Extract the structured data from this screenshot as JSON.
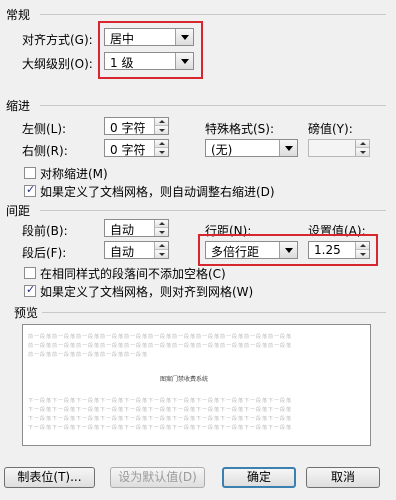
{
  "general": {
    "section_label": "常规",
    "alignment_label": "对齐方式(G):",
    "alignment_value": "居中",
    "outline_label": "大纲级别(O):",
    "outline_value": "1 级"
  },
  "indent": {
    "section_label": "缩进",
    "left_label": "左侧(L):",
    "left_value": "0 字符",
    "right_label": "右侧(R):",
    "right_value": "0 字符",
    "special_label": "特殊格式(S):",
    "special_value": "(无)",
    "by_label": "磅值(Y):",
    "by_value": "",
    "mirror_label": "对称缩进(M)",
    "mirror_checked": false,
    "auto_adjust_label": "如果定义了文档网格，则自动调整右缩进(D)",
    "auto_adjust_checked": true
  },
  "spacing": {
    "section_label": "间距",
    "before_label": "段前(B):",
    "before_value": "自动",
    "after_label": "段后(F):",
    "after_value": "自动",
    "line_spacing_label": "行距(N):",
    "line_spacing_value": "多倍行距",
    "at_label": "设置值(A):",
    "at_value": "1.25",
    "no_space_label": "在相同样式的段落间不添加空格(C)",
    "no_space_checked": false,
    "snap_grid_label": "如果定义了文档网格，则对齐到网格(W)",
    "snap_grid_checked": true
  },
  "preview": {
    "section_label": "预览",
    "before_lines": [
      "前一段落前一段落前一段落前一段落前一段落前一段落前一段落前一段落前一段落前一段落前一段落",
      "前一段落前一段落前一段落前一段落前一段落前一段落前一段落前一段落前一段落前一段落前一段落",
      "前一段落前一段落前一段落前一段落前一段落"
    ],
    "sample_text": "图案门禁收费系统",
    "after_lines": [
      "下一段落下一段落下一段落下一段落下一段落下一段落下一段落下一段落下一段落下一段落下一段落",
      "下一段落下一段落下一段落下一段落下一段落下一段落下一段落下一段落下一段落下一段落下一段落",
      "下一段落下一段落下一段落下一段落下一段落下一段落下一段落下一段落下一段落下一段落下一段落",
      "下一段落下一段落下一段落下一段落下一段落下一段落下一段落下一段落下一段落下一段落下一段落"
    ]
  },
  "buttons": {
    "tabs": "制表位(T)...",
    "set_default": "设为默认值(D)",
    "ok": "确定",
    "cancel": "取消"
  },
  "colors": {
    "highlight_box": "#d8262f",
    "check_mark": "#2a2a8c"
  }
}
